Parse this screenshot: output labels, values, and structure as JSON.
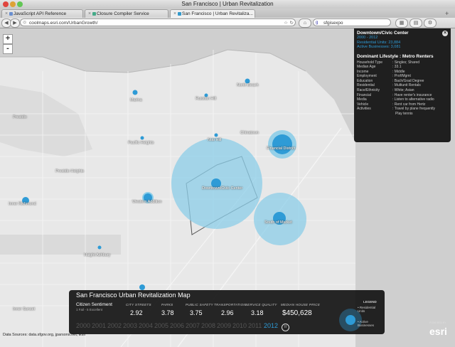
{
  "window": {
    "title": "San Francisco | Urban Revitalization"
  },
  "tabs": [
    {
      "label": "JavaScript API Reference"
    },
    {
      "label": "Closure Compiler Service"
    },
    {
      "label": "San Francisco | Urban Revitaliza..."
    }
  ],
  "toolbar": {
    "url": "coolmaps.esri.com/UrbanGrowth/",
    "search_value": "sfgisexpo"
  },
  "map": {
    "labels": {
      "marina": "Marina",
      "russian_hill": "Russian Hill",
      "north_beach": "North Beach",
      "presidio": "Presidio",
      "pacific_heights": "Pacific Heights",
      "chinatown": "Chinatown",
      "nob_hill": "Nob Hill",
      "financial_district": "Financial District",
      "presidio_heights": "Presidio Heights",
      "downtown_civic": "Downtown/Civic Center",
      "inner_richmond": "Inner Richmond",
      "western_addition": "Western Addition",
      "south_of_market": "South of Market",
      "haight_ashbury": "Haight Ashbury",
      "inner_sunset": "Inner Sunset"
    },
    "zoom_in": "+",
    "zoom_out": "-"
  },
  "info_panel": {
    "title": "Downtown/Civic Center",
    "year_range": "2000 - 2012",
    "residential_units": "Residential Units: 23,884",
    "active_businesses": "Active Businesses: 3,081",
    "lifestyle": "Dominant Lifestyle : Metro Renters",
    "close": "×",
    "attributes": [
      {
        "key": "Household Type",
        "value": ": Singles; Shared"
      },
      {
        "key": "Median Age",
        "value": ": 33.1"
      },
      {
        "key": "Income",
        "value": ": Middle"
      },
      {
        "key": "Employment",
        "value": ": Prof/Mgmt"
      },
      {
        "key": "Education",
        "value": ": Bach/Grad Degree"
      },
      {
        "key": "Residential",
        "value": ": Multiunit Rentals"
      },
      {
        "key": "Race/Ethnicity",
        "value": ": White; Asian"
      },
      {
        "key": "Financial",
        "value": ": Have renter's insurance"
      },
      {
        "key": "Media",
        "value": ": Listen to alternative radio"
      },
      {
        "key": "Vehicle",
        "value": ": Rent car from Hertz"
      },
      {
        "key": "Activities",
        "value": ": Travel by plane frequently"
      },
      {
        "key": "",
        "value": "Play tennis"
      }
    ]
  },
  "bottom_panel": {
    "title": "San Francisco Urban Revitalization Map",
    "sentiment_label": "Citizen Sentiment",
    "sentiment_scale": "1 Fail - 5 Excellent",
    "metrics": [
      {
        "label": "CITY STREETS",
        "value": "2.92"
      },
      {
        "label": "PARKS",
        "value": "3.78"
      },
      {
        "label": "PUBLIC SAFETY",
        "value": "3.75"
      },
      {
        "label": "TRANSPORTATION",
        "value": "2.96"
      },
      {
        "label": "SERVICE QUALITY",
        "value": "3.18"
      }
    ],
    "median_label": "MEDIAN HOUSE PRICE",
    "median_value": "$450,628",
    "years": [
      "2000",
      "2001",
      "2002",
      "2003",
      "2004",
      "2005",
      "2006",
      "2007",
      "2008",
      "2009",
      "2010",
      "2011",
      "2012"
    ],
    "active_year": "2012",
    "play": "II",
    "legend": {
      "title": "LEGEND",
      "residential": "Residential Units",
      "businesses": "Active Businesses"
    }
  },
  "footer": {
    "data_sources": "Data Sources: data.sfgov.org, jparsons.net, Esri",
    "powered_by": "POWERED BY",
    "brand": "esri"
  },
  "colors": {
    "accent": "#2e9bd6",
    "bubble": "#8ccde8",
    "panel": "#1f1f1f"
  }
}
